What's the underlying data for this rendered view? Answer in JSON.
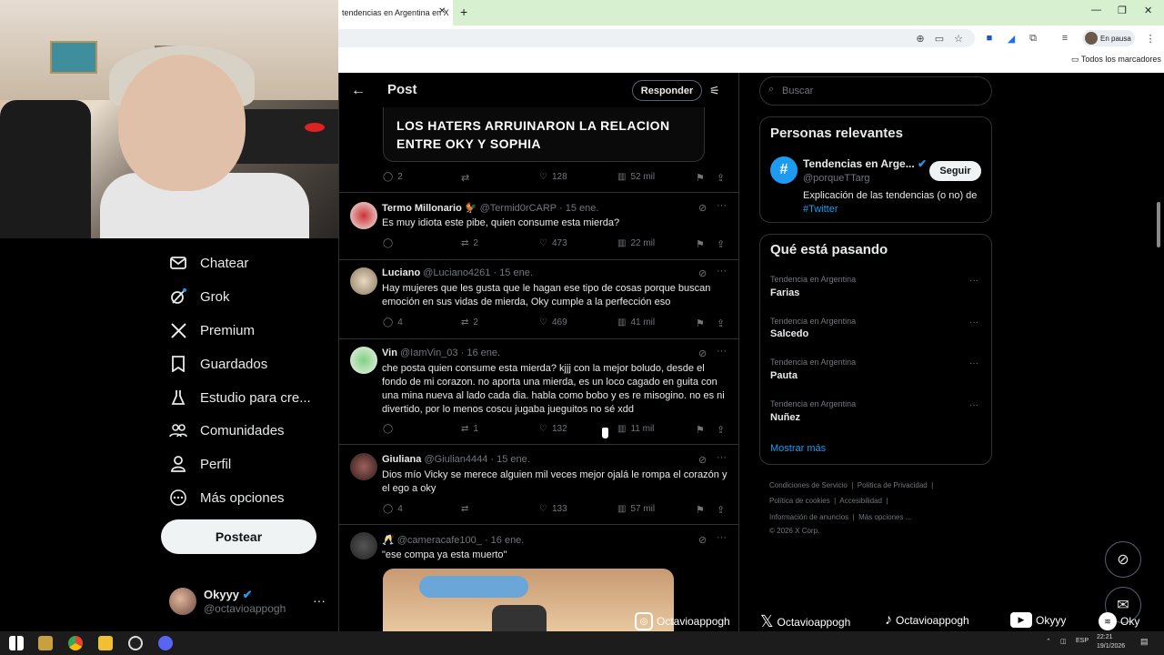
{
  "browser": {
    "tab_title": "tendencias en Argentina en X",
    "pause_label": "En pausa",
    "bookmarks_label": "Todos los marcadores"
  },
  "sidebar": {
    "items": [
      {
        "label": "Chatear",
        "icon": "mail-icon"
      },
      {
        "label": "Grok",
        "icon": "grok-icon"
      },
      {
        "label": "Premium",
        "icon": "x-logo-icon"
      },
      {
        "label": "Guardados",
        "icon": "bookmark-icon"
      },
      {
        "label": "Estudio para cre...",
        "icon": "flask-icon"
      },
      {
        "label": "Comunidades",
        "icon": "people-icon"
      },
      {
        "label": "Perfil",
        "icon": "person-icon"
      },
      {
        "label": "Más opciones",
        "icon": "more-circle-icon"
      }
    ],
    "post_button": "Postear",
    "account": {
      "name": "Okyyy",
      "handle": "@octavioappogh"
    }
  },
  "post": {
    "title": "Post",
    "reply_button": "Responder",
    "video_text": "LOS HATERS ARRUINARON LA RELACION ENTRE OKY Y SOPHIA",
    "stats": {
      "replies": "2",
      "likes": "128",
      "views": "52 mil"
    }
  },
  "replies": [
    {
      "name": "Termo Millonario 🐓",
      "handle": "@Termid0rCARP",
      "date": "· 15 ene.",
      "text": "Es muy idiota este pibe, quien consume esta mierda?",
      "replies": "",
      "reposts": "2",
      "likes": "473",
      "views": "22 mil"
    },
    {
      "name": "Luciano",
      "handle": "@Luciano4261",
      "date": "· 15 ene.",
      "text": "Hay mujeres que les gusta que le hagan ese tipo de cosas porque buscan emoción en sus vidas de mierda, Oky cumple a la perfección eso",
      "replies": "4",
      "reposts": "2",
      "likes": "469",
      "views": "41 mil"
    },
    {
      "name": "Vin",
      "handle": "@IamVin_03",
      "date": "· 16 ene.",
      "text": "che posta quien consume esta mierda? kjjj con la mejor boludo, desde el fondo de mi corazon. no aporta una mierda, es un loco cagado en guita con una mina nueva al lado cada dia. habla como bobo y es re misogino. no es ni divertido, por lo menos coscu jugaba jueguitos no sé xdd",
      "replies": "",
      "reposts": "1",
      "likes": "132",
      "views": "11 mil"
    },
    {
      "name": "Giuliana",
      "handle": "@Giulian4444",
      "date": "· 15 ene.",
      "text": "Dios mío Vicky se merece alguien mil veces mejor ojalá le rompa el corazón y el ego a oky",
      "replies": "4",
      "reposts": "",
      "likes": "133",
      "views": "57 mil"
    },
    {
      "name": "🥂",
      "handle": "@cameracafe100_",
      "date": "· 16 ene.",
      "text": "\"ese compa ya esta muerto\""
    }
  ],
  "right": {
    "search_placeholder": "Buscar",
    "relevant_title": "Personas relevantes",
    "relevant": {
      "name": "Tendencias en Arge...",
      "handle": "@porqueTTarg",
      "follow": "Seguir",
      "bio": "Explicación de las tendencias (o no) de",
      "bio_tag": "#Twitter"
    },
    "happening_title": "Qué está pasando",
    "trends": [
      {
        "context": "Tendencia en Argentina",
        "name": "Farias"
      },
      {
        "context": "Tendencia en Argentina",
        "name": "Salcedo"
      },
      {
        "context": "Tendencia en Argentina",
        "name": "Pauta"
      },
      {
        "context": "Tendencia en Argentina",
        "name": "Nuñez"
      }
    ],
    "show_more": "Mostrar más",
    "footer": {
      "line1a": "Condiciones de Servicio",
      "line1b": "Política de Privacidad",
      "line2a": "Política de cookies",
      "line2b": "Accesibilidad",
      "line3a": "Información de anuncios",
      "line3b": "Más opciones ...",
      "copyright": "© 2026 X Corp."
    }
  },
  "overlay": {
    "instagram": "Octavioappogh",
    "x": "Octavioappogh",
    "tiktok": "Octavioappogh",
    "youtube": "Okyyy",
    "spotify": "Oky"
  },
  "taskbar": {
    "lang": "ESP",
    "time": "22:21",
    "date": "19/1/2026"
  },
  "colors": {
    "accent": "#1d9bf0",
    "background": "#000000",
    "chrome_tab_bg": "#d7f0d0"
  }
}
